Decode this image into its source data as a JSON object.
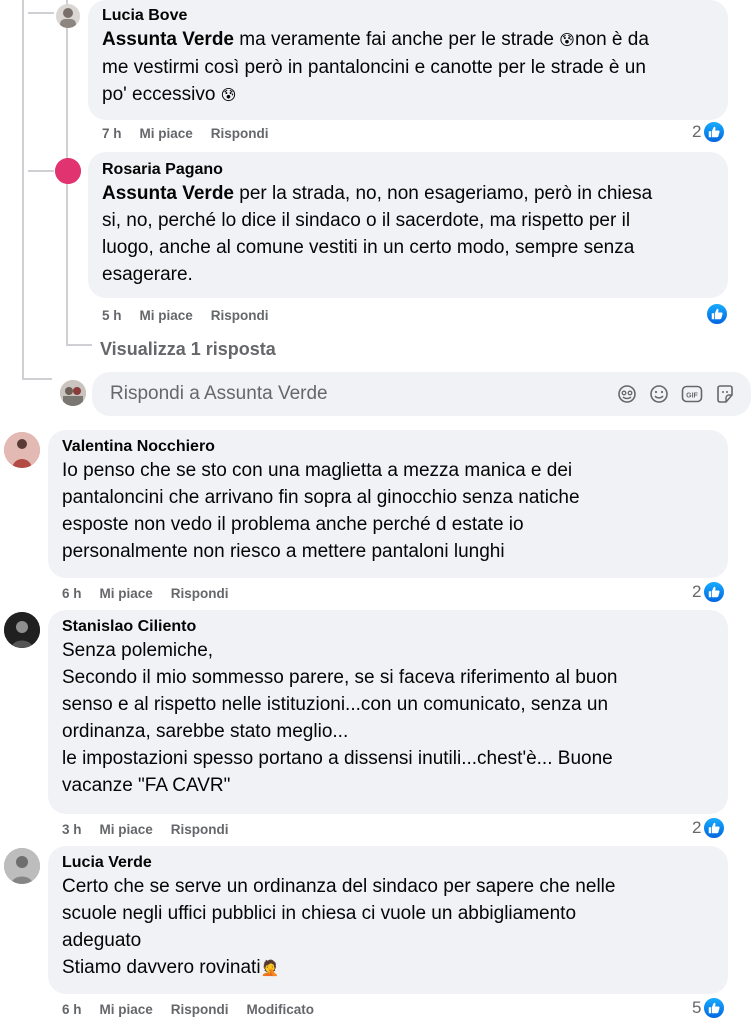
{
  "comments": [
    {
      "author": "Lucia Bove",
      "tag": "Assunta Verde",
      "lines": [
        " ma veramente fai anche per le strade ",
        "non è da",
        "me vestirmi così però in pantaloncini e canotte per le strade è un",
        "po' eccessivo "
      ],
      "time": "7 h",
      "like": "Mi piace",
      "reply": "Rispondi",
      "reactions": "2"
    },
    {
      "author": "Rosaria Pagano",
      "tag": "Assunta Verde",
      "lines": [
        " per la strada, no, non esageriamo, però in chiesa",
        "si, no, perché lo dice il sindaco o il sacerdote, ma rispetto per il",
        "luogo, anche al comune vestiti in un certo modo, sempre senza",
        "esagerare."
      ],
      "time": "5 h",
      "like": "Mi piace",
      "reply": "Rispondi",
      "reactions": ""
    },
    {
      "author": "Valentina Nocchiero",
      "lines": [
        "Io penso che se sto con una maglietta a mezza manica e dei",
        "pantaloncini che arrivano fin sopra al ginocchio senza natiche",
        "esposte non vedo il problema anche perché d estate io",
        "personalmente non riesco a mettere pantaloni lunghi"
      ],
      "time": "6 h",
      "like": "Mi piace",
      "reply": "Rispondi",
      "reactions": "2"
    },
    {
      "author": "Stanislao Ciliento",
      "lines": [
        "Senza polemiche,",
        "Secondo il mio sommesso parere, se si faceva riferimento al buon",
        "senso e al rispetto nelle istituzioni...con un comunicato, senza un",
        "ordinanza, sarebbe stato meglio...",
        "le impostazioni spesso portano a dissensi inutili...chest'è... Buone",
        "vacanze \"FA CAVR\""
      ],
      "time": "3 h",
      "like": "Mi piace",
      "reply": "Rispondi",
      "reactions": "2"
    },
    {
      "author": "Lucia Verde",
      "lines": [
        "Certo che se serve un ordinanza del sindaco per sapere che nelle",
        "scuole negli uffici pubblici in chiesa ci vuole un abbigliamento",
        "adeguato",
        "Stiamo davvero rovinati"
      ],
      "time": "6 h",
      "like": "Mi piace",
      "reply": "Rispondi",
      "edited": "Modificato",
      "reactions": "5"
    }
  ],
  "view_replies": "Visualizza 1 risposta",
  "reply_box": {
    "placeholder": "Rispondi a Assunta Verde"
  },
  "icons": {
    "emoji": [
      "face-sweat-icon",
      "face-sweat-icon",
      "person-gesture-icon"
    ],
    "reply_tools": [
      "avatar-sticker-icon",
      "smiley-icon",
      "gif-icon",
      "sticker-icon"
    ],
    "reaction": "like-icon"
  },
  "colors": {
    "bubble": "#f0f2f5",
    "text": "#050505",
    "meta": "#65676b",
    "like_blue": "#0866ff",
    "thread_line": "#ced0d4"
  }
}
